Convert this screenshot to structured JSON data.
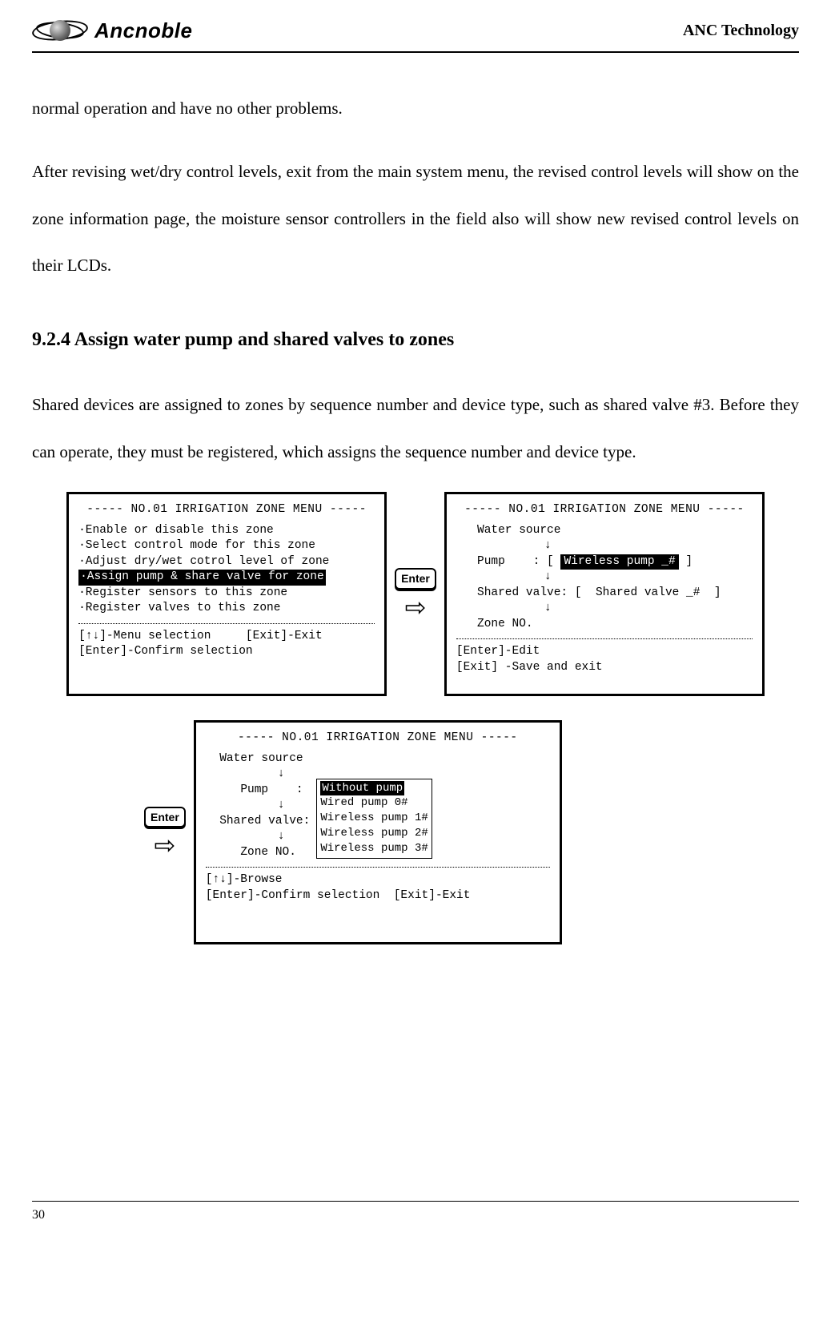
{
  "header": {
    "logo_text": "Ancnoble",
    "company": "ANC Technology"
  },
  "paragraphs": {
    "p1": "normal operation and have no other problems.",
    "p2": "After revising wet/dry control levels, exit from the main system menu, the revised control levels will show on the zone information page, the moisture sensor controllers in the field also will show new revised control levels on their LCDs."
  },
  "section": {
    "number": "9.2.4",
    "title": "Assign water pump and shared valves to zones",
    "body": "Shared devices are assigned to zones by sequence number and device type, such as shared valve #3. Before they can operate, they must be registered, which assigns the sequence number and device type."
  },
  "lcd_common": {
    "title": "----- NO.01 IRRIGATION ZONE MENU -----",
    "enter_label": "Enter"
  },
  "panel1": {
    "items": [
      "·Enable or disable this zone",
      "·Select control mode for this zone",
      "·Adjust dry/wet cotrol level of zone",
      "·Assign pump & share valve for zone",
      "·Register sensors to this zone",
      "·Register valves to this zone"
    ],
    "selected_index": 3,
    "footer1": "[↑↓]-Menu selection     [Exit]-Exit",
    "footer2": "[Enter]-Confirm selection"
  },
  "panel2": {
    "water_source": "Water source",
    "pump_label": "Pump    :",
    "pump_value": "Wireless pump _#",
    "shared_label": "Shared valve:",
    "shared_value": "Shared valve _#",
    "zone_label": "Zone NO.",
    "footer1": "[Enter]-Edit",
    "footer2": "[Exit] -Save and exit"
  },
  "panel3": {
    "water_source": "Water source",
    "pump_label": "Pump    :",
    "shared_label": "Shared valve:",
    "zone_label": "Zone NO.",
    "options": [
      "Without pump",
      "Wired pump 0#",
      "Wireless pump 1#",
      "Wireless pump 2#",
      "Wireless pump 3#"
    ],
    "selected_option_index": 0,
    "footer1": "[↑↓]-Browse",
    "footer2": "[Enter]-Confirm selection  [Exit]-Exit"
  },
  "page_number": "30"
}
